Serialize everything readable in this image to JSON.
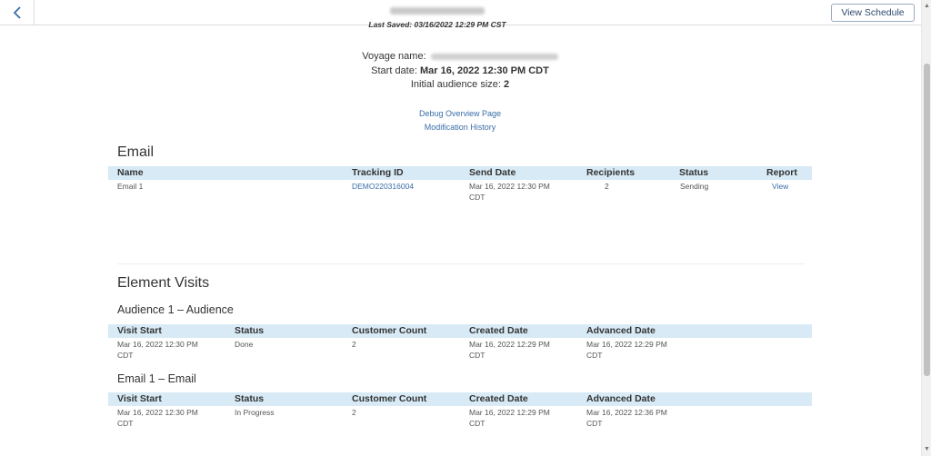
{
  "header": {
    "last_saved": "Last Saved: 03/16/2022 12:29 PM CST",
    "view_schedule_label": "View Schedule"
  },
  "summary": {
    "voyage_name_label": "Voyage name:",
    "start_date_label": "Start date:",
    "start_date_value": "Mar 16, 2022 12:30 PM CDT",
    "audience_size_label": "Initial audience size:",
    "audience_size_value": "2"
  },
  "links": {
    "debug": "Debug Overview Page",
    "history": "Modification History"
  },
  "email_section": {
    "title": "Email",
    "columns": [
      "Name",
      "Tracking ID",
      "Send Date",
      "Recipients",
      "Status",
      "Report"
    ],
    "rows": [
      {
        "name": "Email 1",
        "tracking_id": "DEMO220316004",
        "send_date_1": "Mar 16, 2022 12:30 PM",
        "send_date_2": "CDT",
        "recipients": "2",
        "status": "Sending",
        "report": "View"
      }
    ]
  },
  "visits_section": {
    "title": "Element Visits",
    "groups": [
      {
        "title": "Audience 1 – Audience",
        "columns": [
          "Visit Start",
          "Status",
          "Customer Count",
          "Created Date",
          "Advanced Date"
        ],
        "row": {
          "visit_start_1": "Mar 16, 2022 12:30 PM",
          "visit_start_2": "CDT",
          "status": "Done",
          "count": "2",
          "created_1": "Mar 16, 2022 12:29 PM",
          "created_2": "CDT",
          "advanced_1": "Mar 16, 2022 12:29 PM",
          "advanced_2": "CDT"
        }
      },
      {
        "title": "Email 1 – Email",
        "columns": [
          "Visit Start",
          "Status",
          "Customer Count",
          "Created Date",
          "Advanced Date"
        ],
        "row": {
          "visit_start_1": "Mar 16, 2022 12:30 PM",
          "visit_start_2": "CDT",
          "status": "In Progress",
          "count": "2",
          "created_1": "Mar 16, 2022 12:29 PM",
          "created_2": "CDT",
          "advanced_1": "Mar 16, 2022 12:36 PM",
          "advanced_2": "CDT"
        }
      }
    ]
  },
  "colors": {
    "table_header_bg": "#d7eaf5",
    "link": "#3a6ea8"
  },
  "icons": {
    "back": "chevron-left-icon",
    "scroll_up": "scroll-up-arrow-icon",
    "scroll_down": "scroll-down-arrow-icon"
  }
}
